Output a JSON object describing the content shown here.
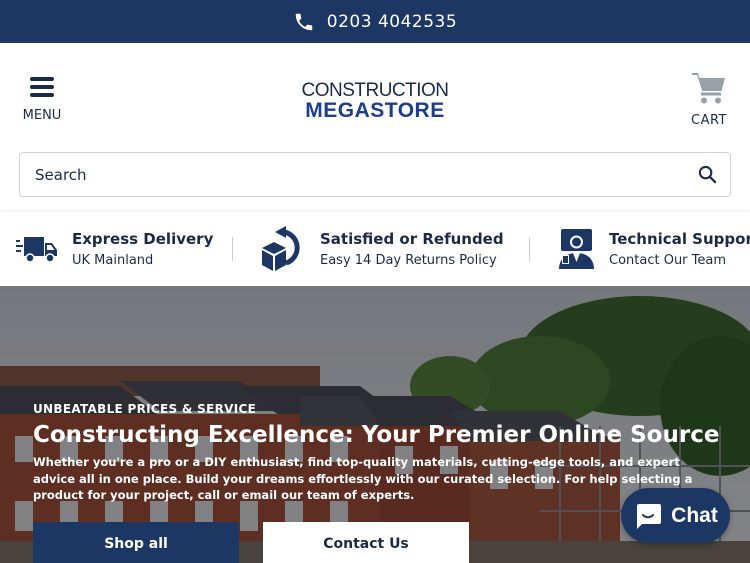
{
  "topbar": {
    "phone": "0203 4042535",
    "icon": "phone-icon"
  },
  "header": {
    "menu_label": "MENU",
    "logo_line1": "CONSTRUCTION",
    "logo_line2": "MEGASTORE",
    "cart_label": "CART"
  },
  "search": {
    "placeholder": "Search",
    "value": ""
  },
  "usps": [
    {
      "title": "Express Delivery",
      "subtitle": "UK Mainland",
      "icon": "truck-icon"
    },
    {
      "title": "Satisfied or Refunded",
      "subtitle": "Easy 14 Day Returns Policy",
      "icon": "returns-box-icon"
    },
    {
      "title": "Technical Support",
      "subtitle": "Contact Our Team",
      "icon": "support-agent-icon"
    }
  ],
  "hero": {
    "eyebrow": "UNBEATABLE PRICES & SERVICE",
    "headline": "Constructing Excellence: Your Premier Online Source",
    "body": "Whether you're a pro or a DIY enthusiast, find top-quality materials, cutting-edge tools, and expert advice all in one place. Build your dreams effortlessly with our curated selection. For help selecting a product for your project, call or email our team of experts.",
    "primary_button": "Shop all",
    "secondary_button": "Contact Us"
  },
  "chat": {
    "label": "Chat",
    "icon": "chat-bubble-icon"
  },
  "colors": {
    "brand_navy": "#1d3765",
    "text_dark": "#1b2a4a",
    "chat_bg": "#1d3765"
  }
}
